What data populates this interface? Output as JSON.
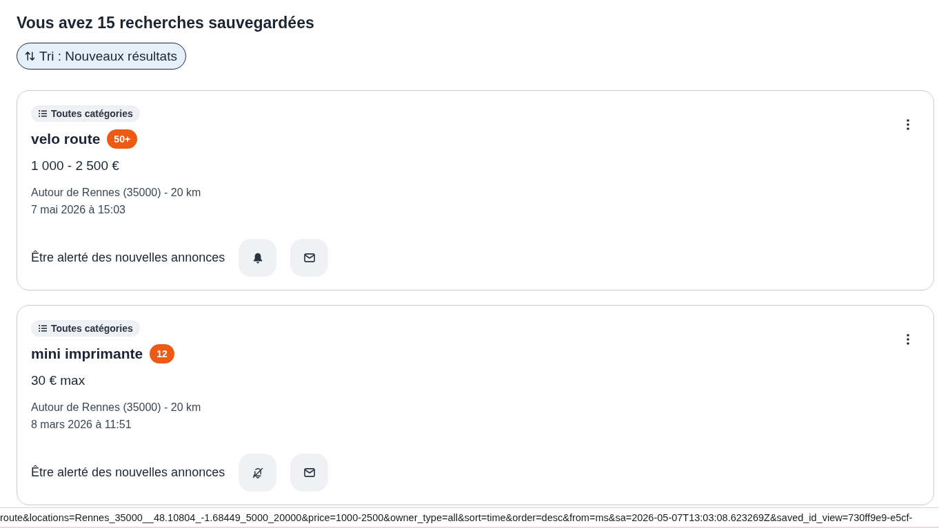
{
  "heading": "Vous avez 15 recherches sauvegardées",
  "sort_button": {
    "label": "Tri : Nouveaux résultats"
  },
  "saved_searches": [
    {
      "category": "Toutes catégories",
      "title": "velo route",
      "new_results": "50+",
      "price": "1 000 - 2 500 €",
      "location": "Autour de Rennes (35000) - 20 km",
      "date": "7 mai 2026 à 15:03",
      "alert_label": "Être alerté des nouvelles annonces",
      "push_alert_on": true
    },
    {
      "category": "Toutes catégories",
      "title": "mini imprimante",
      "new_results": "12",
      "price": "30 € max",
      "location": "Autour de Rennes (35000) - 20 km",
      "date": "8 mars 2026 à 11:51",
      "alert_label": "Être alerté des nouvelles annonces",
      "push_alert_on": false
    }
  ],
  "status_bar": {
    "url": "route&locations=Rennes_35000__48.10804_-1.68449_5000_20000&price=1000-2500&owner_type=all&sort=time&order=desc&from=ms&sa=2026-05-07T13:03:08.623269Z&saved_id_view=730ff9e9-e5cf-"
  }
}
